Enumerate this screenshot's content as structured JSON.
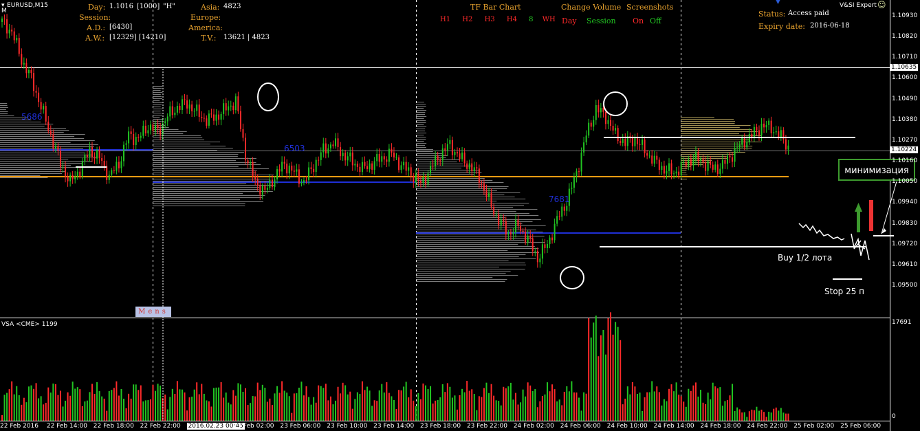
{
  "chart_title": "EURUSD,M15",
  "chart_sub": "M",
  "info": {
    "day_label": "Day:",
    "day_value": "1.1016",
    "day_bracket": "[1000]",
    "day_code": "\"H\"",
    "session_label": "Session:",
    "ad_label": "A.D.:",
    "ad_value": "[6430]",
    "aw_label": "A.W.:",
    "aw_value": "[12329] [14210]",
    "asia_label": "Asia:",
    "asia_value": "4823",
    "europe_label": "Europe:",
    "america_label": "America:",
    "tv_label": "T.V.:",
    "tv_value": "13621 | 4823"
  },
  "tf_bar": {
    "title": "TF Bar Chart",
    "buttons": [
      "H1",
      "H2",
      "H3",
      "H4",
      "8",
      "WH"
    ]
  },
  "change_volume": {
    "title": "Change Volume",
    "day": "Day",
    "session": "Session"
  },
  "screenshots": {
    "title": "Screenshots",
    "on": "On",
    "off": "Off"
  },
  "status": {
    "status_label": "Status:",
    "status_value": "Access paid",
    "expiry_label": "Expiry date:",
    "expiry_value": "2016-06-18"
  },
  "expert": {
    "name": "V&SI Expert"
  },
  "profile_labels": [
    "5686",
    "6503",
    "7681"
  ],
  "annotations": {
    "buy": "Buy 1/2 лота",
    "stop": "Stop 25 п",
    "minimize": "минимизация",
    "mens": "Mens"
  },
  "volume_panel": {
    "label": "VSA <CME> 1199",
    "max": "17691",
    "zero": "0"
  },
  "current_price": "1.10224",
  "marked_price": "1.10635",
  "colors": {
    "bull": "#22c522",
    "bear": "#ff2a2a",
    "orange": "#f39c12",
    "blue": "#1f2fd6"
  },
  "chart_data": {
    "type": "candlestick",
    "symbol": "EURUSD",
    "timeframe": "M15",
    "y_ticks": [
      "1.10930",
      "1.10820",
      "1.10710",
      "1.10600",
      "1.10490",
      "1.10380",
      "1.10270",
      "1.10160",
      "1.10050",
      "1.09940",
      "1.09830",
      "1.09720",
      "1.09610",
      "1.09500"
    ],
    "ylim": [
      1.0945,
      1.1098
    ],
    "x_ticks": [
      "22 Feb 2016",
      "22 Feb 14:00",
      "22 Feb 18:00",
      "22 Feb 22:00",
      "2016.02.23 00:45",
      "23 Feb 02:00",
      "23 Feb 06:00",
      "23 Feb 10:00",
      "23 Feb 14:00",
      "23 Feb 18:00",
      "23 Feb 22:00",
      "24 Feb 02:00",
      "24 Feb 06:00",
      "24 Feb 10:00",
      "24 Feb 14:00",
      "24 Feb 18:00",
      "24 Feb 22:00",
      "25 Feb 02:00",
      "25 Feb 06:00"
    ],
    "price_path": [
      [
        0,
        1.109
      ],
      [
        4,
        1.1085
      ],
      [
        8,
        1.107
      ],
      [
        12,
        1.106
      ],
      [
        16,
        1.1045
      ],
      [
        20,
        1.103
      ],
      [
        24,
        1.1015
      ],
      [
        28,
        1.1005
      ],
      [
        32,
        1.1012
      ],
      [
        36,
        1.1022
      ],
      [
        40,
        1.1018
      ],
      [
        44,
        1.1008
      ],
      [
        48,
        1.1015
      ],
      [
        52,
        1.103
      ],
      [
        56,
        1.1028
      ],
      [
        60,
        1.1035
      ],
      [
        64,
        1.1032
      ],
      [
        68,
        1.104
      ],
      [
        72,
        1.1045
      ],
      [
        76,
        1.1047
      ],
      [
        80,
        1.1042
      ],
      [
        84,
        1.1038
      ],
      [
        88,
        1.104
      ],
      [
        92,
        1.1044
      ],
      [
        96,
        1.1048
      ],
      [
        100,
        1.102
      ],
      [
        104,
        1.1005
      ],
      [
        108,
        1.1
      ],
      [
        112,
        1.1008
      ],
      [
        116,
        1.1015
      ],
      [
        120,
        1.101
      ],
      [
        124,
        1.1005
      ],
      [
        128,
        1.1014
      ],
      [
        132,
        1.1022
      ],
      [
        136,
        1.1026
      ],
      [
        140,
        1.102
      ],
      [
        144,
        1.1016
      ],
      [
        148,
        1.1012
      ],
      [
        152,
        1.1015
      ],
      [
        156,
        1.1018
      ],
      [
        160,
        1.102
      ],
      [
        164,
        1.1014
      ],
      [
        168,
        1.101
      ],
      [
        172,
        1.1004
      ],
      [
        176,
        1.1012
      ],
      [
        180,
        1.102
      ],
      [
        184,
        1.1025
      ],
      [
        188,
        1.1018
      ],
      [
        192,
        1.1014
      ],
      [
        196,
        1.1008
      ],
      [
        200,
        1.0995
      ],
      [
        204,
        1.0985
      ],
      [
        208,
        1.0978
      ],
      [
        212,
        1.0982
      ],
      [
        216,
        1.0975
      ],
      [
        220,
        1.0965
      ],
      [
        224,
        1.0972
      ],
      [
        228,
        1.0985
      ],
      [
        232,
        1.0995
      ],
      [
        236,
        1.101
      ],
      [
        240,
        1.103
      ],
      [
        244,
        1.1044
      ],
      [
        248,
        1.104
      ],
      [
        252,
        1.103
      ],
      [
        256,
        1.1026
      ],
      [
        260,
        1.1028
      ],
      [
        264,
        1.1022
      ],
      [
        268,
        1.1016
      ],
      [
        272,
        1.1012
      ],
      [
        276,
        1.101
      ],
      [
        280,
        1.1014
      ],
      [
        284,
        1.1018
      ],
      [
        288,
        1.1016
      ],
      [
        292,
        1.1012
      ],
      [
        296,
        1.1014
      ],
      [
        300,
        1.102
      ],
      [
        304,
        1.1026
      ],
      [
        308,
        1.103
      ],
      [
        312,
        1.1035
      ],
      [
        316,
        1.1034
      ],
      [
        320,
        1.1029
      ],
      [
        324,
        1.1022
      ]
    ],
    "volume_max": 17691
  }
}
